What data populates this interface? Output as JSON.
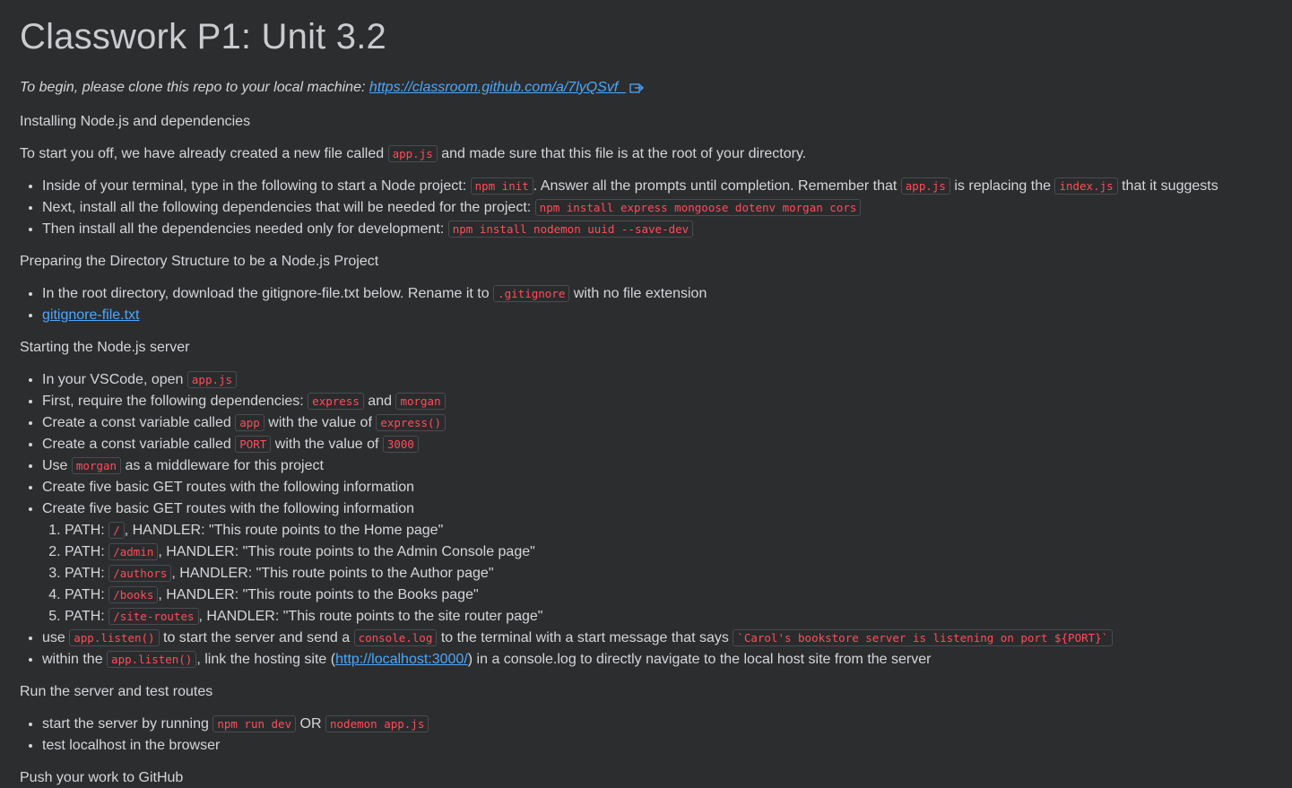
{
  "title": "Classwork P1: Unit 3.2",
  "intro": {
    "text": "To begin, please clone this repo to your local machine: ",
    "link": "https://classroom.github.com/a/7lyQSvf_"
  },
  "section1": {
    "heading": "Installing Node.js and dependencies",
    "para": {
      "a": "To start you off, we have already created a new file called ",
      "code": "app.js",
      "b": " and made sure that this file is at the root of your directory."
    },
    "items": [
      {
        "a": "Inside of your terminal, type in the following to start a Node project: ",
        "c1": "npm init",
        "b": ". Answer all the prompts until completion. Remember that ",
        "c2": "app.js",
        "c": " is replacing the ",
        "c3": "index.js",
        "d": " that it suggests"
      },
      {
        "a": "Next, install all the following dependencies that will be needed for the project: ",
        "c1": "npm install express mongoose dotenv morgan cors"
      },
      {
        "a": "Then install all the dependencies needed only for development: ",
        "c1": "npm install nodemon uuid --save-dev"
      }
    ]
  },
  "section2": {
    "heading": "Preparing the Directory Structure to be a Node.js Project",
    "items": [
      {
        "a": "In the root directory, download the gitignore-file.txt below. Rename it to ",
        "c1": ".gitignore",
        "b": " with no file extension"
      },
      {
        "link": "gitignore-file.txt"
      }
    ]
  },
  "section3": {
    "heading": "Starting the Node.js server",
    "items": [
      {
        "a": "In your VSCode, open ",
        "c1": "app.js"
      },
      {
        "a": "First, require the following dependencies: ",
        "c1": "express",
        "b": " and ",
        "c2": "morgan"
      },
      {
        "a": "Create a const variable called ",
        "c1": "app",
        "b": " with the value of ",
        "c2": "express()"
      },
      {
        "a": "Create a const variable called ",
        "c1": "PORT",
        "b": " with the value of ",
        "c2": "3000"
      },
      {
        "a": "Use ",
        "c1": "morgan",
        "b": " as a middleware for this project"
      },
      {
        "a": "Create five  basic GET routes with the following information"
      },
      {
        "a": "Create five  basic GET routes with the following information"
      }
    ],
    "routes": [
      {
        "a": "PATH: ",
        "c1": "/",
        "b": ", HANDLER: \"This route points to the Home page\""
      },
      {
        "a": "PATH: ",
        "c1": "/admin",
        "b": ", HANDLER: \"This route points to the Admin Console page\""
      },
      {
        "a": "PATH: ",
        "c1": "/authors",
        "b": ", HANDLER: \"This route points to the Author page\""
      },
      {
        "a": "PATH: ",
        "c1": "/books",
        "b": ", HANDLER: \"This route points to the Books page\""
      },
      {
        "a": "PATH: ",
        "c1": "/site-routes",
        "b": ", HANDLER: \"This route points to the site router page\""
      }
    ],
    "after": [
      {
        "a": "use ",
        "c1": "app.listen()",
        "b": " to start the server and send a ",
        "c2": "console.log",
        "c": " to the terminal with a start message that says ",
        "c3": "`Carol's bookstore server is listening on port ${PORT}`"
      },
      {
        "a": "within the ",
        "c1": "app.listen()",
        "b": ", link the hosting site (",
        "link": "http://localhost:3000/",
        "c": ") in a console.log to directly navigate to the local host site from the server"
      }
    ]
  },
  "section4": {
    "heading": "Run the server and test routes",
    "items": [
      {
        "a": "start the server by running ",
        "c1": "npm run dev",
        "b": " OR ",
        "c2": "nodemon app.js"
      },
      {
        "a": "test localhost in the browser"
      }
    ]
  },
  "section5": {
    "heading": "Push your work to GitHub"
  }
}
